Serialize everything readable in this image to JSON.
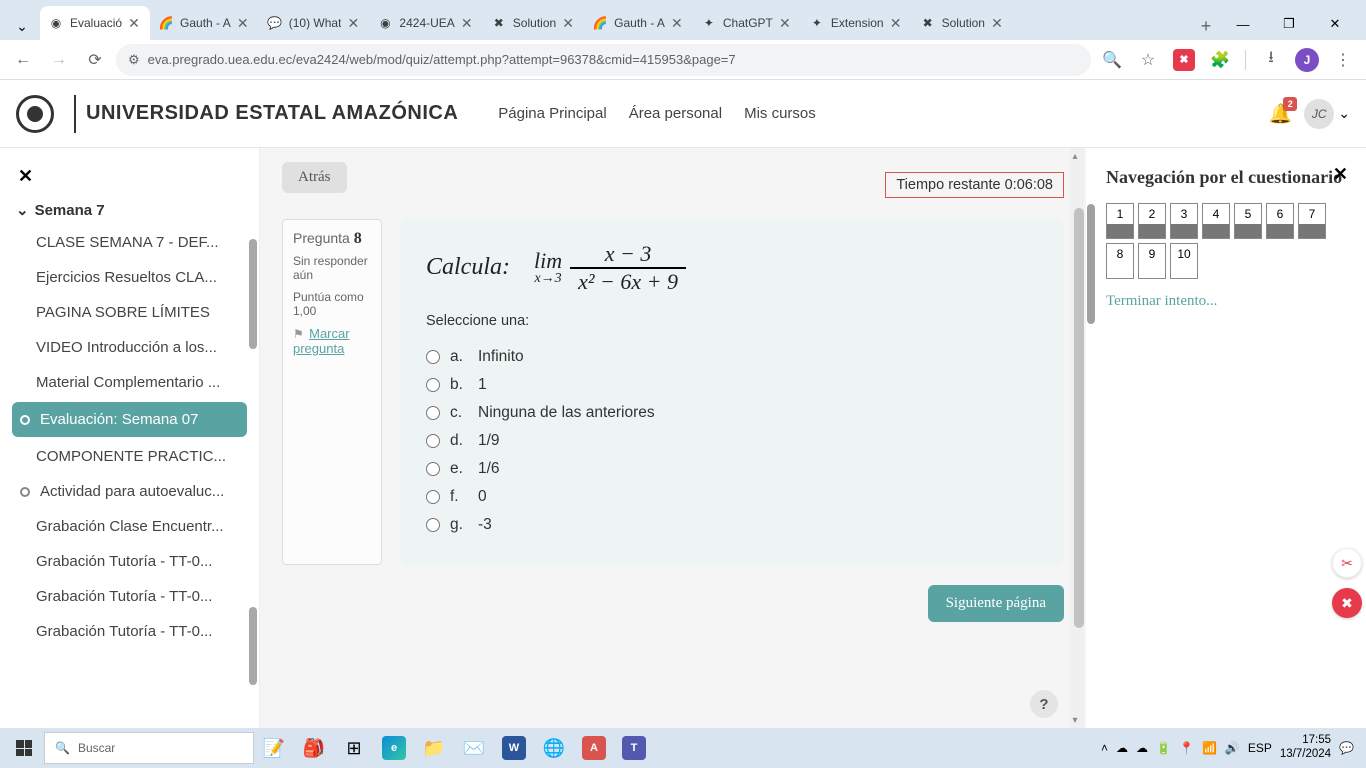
{
  "browser": {
    "tabs": [
      {
        "title": "Evaluació",
        "favicon": "◉"
      },
      {
        "title": "Gauth - A",
        "favicon": "🌈"
      },
      {
        "title": "(10) What",
        "favicon": "💬"
      },
      {
        "title": "2424-UEA",
        "favicon": "◉"
      },
      {
        "title": "Solution",
        "favicon": "✖"
      },
      {
        "title": "Gauth - A",
        "favicon": "🌈"
      },
      {
        "title": "ChatGPT",
        "favicon": "✦"
      },
      {
        "title": "Extension",
        "favicon": "✦"
      },
      {
        "title": "Solution",
        "favicon": "✖"
      }
    ],
    "url": "eva.pregrado.uea.edu.ec/eva2424/web/mod/quiz/attempt.php?attempt=96378&cmid=415953&page=7",
    "profile_initial": "J"
  },
  "site": {
    "title": "UNIVERSIDAD ESTATAL AMAZÓNICA",
    "nav": {
      "home": "Página Principal",
      "area": "Área personal",
      "courses": "Mis cursos"
    },
    "notif_count": "2",
    "user_initials": "JC"
  },
  "sidebar": {
    "section_label": "Semana 7",
    "items": [
      "CLASE SEMANA 7 - DEF...",
      "Ejercicios Resueltos CLA...",
      "PAGINA SOBRE LÍMITES",
      "VIDEO Introducción a los...",
      "Material Complementario ...",
      "Evaluación: Semana 07",
      "COMPONENTE PRACTIC...",
      "Actividad para autoevaluc...",
      "Grabación Clase Encuentr...",
      "Grabación Tutoría - TT-0...",
      "Grabación Tutoría - TT-0...",
      "Grabación Tutoría - TT-0..."
    ]
  },
  "main": {
    "back_label": "Atrás",
    "timer_label": "Tiempo restante 0:06:08",
    "question": {
      "label_prefix": "Pregunta",
      "number": "8",
      "status": "Sin responder aún",
      "points_label": "Puntúa como 1,00",
      "flag_label": "Marcar pregunta",
      "calc_label": "Calcula:",
      "lim_text": "lim",
      "lim_sub": "x→3",
      "numerator": "x − 3",
      "denominator": "x² − 6x + 9",
      "select_prompt": "Seleccione una:",
      "options": [
        {
          "letter": "a.",
          "text": "Infinito"
        },
        {
          "letter": "b.",
          "text": "1"
        },
        {
          "letter": "c.",
          "text": "Ninguna de las anteriores"
        },
        {
          "letter": "d.",
          "text": "1/9"
        },
        {
          "letter": "e.",
          "text": "1/6"
        },
        {
          "letter": "f.",
          "text": "0"
        },
        {
          "letter": "g.",
          "text": "-3"
        }
      ]
    },
    "next_label": "Siguiente página",
    "help_label": "?"
  },
  "rightpanel": {
    "title": "Navegación por el cuestionario",
    "questions": [
      "1",
      "2",
      "3",
      "4",
      "5",
      "6",
      "7",
      "8",
      "9",
      "10"
    ],
    "answered_until": 7,
    "finish_label": "Terminar intento..."
  },
  "taskbar": {
    "search_placeholder": "Buscar",
    "lang": "ESP",
    "time": "17:55",
    "date": "13/7/2024"
  }
}
